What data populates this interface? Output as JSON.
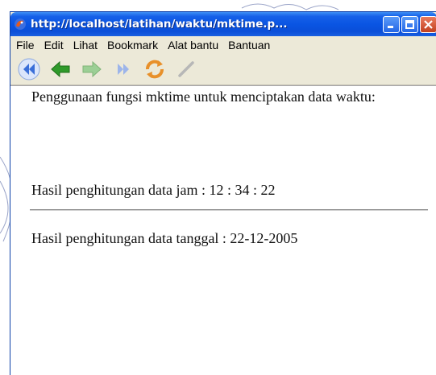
{
  "window": {
    "title": "http://localhost/latihan/waktu/mktime.p...",
    "controls": {
      "minimize": "minimize-icon",
      "maximize": "maximize-icon",
      "close": "close-icon"
    }
  },
  "menubar": {
    "items": [
      "File",
      "Edit",
      "Lihat",
      "Bookmark",
      "Alat bantu",
      "Bantuan"
    ]
  },
  "toolbar": {
    "icons": [
      "rewind-icon",
      "back-arrow-icon",
      "forward-arrow-icon",
      "fast-forward-icon",
      "reload-icon",
      "stop-icon"
    ]
  },
  "content": {
    "intro": "Penggunaan fungsi mktime untuk menciptakan data waktu:",
    "time_line": "Hasil penghitungan data jam : 12 : 34 : 22",
    "date_line": "Hasil penghitungan data tanggal : 22-12-2005"
  },
  "colors": {
    "titlebar": "#0a55e3",
    "chrome": "#ece9d8",
    "arrow_green": "#2f9a2a",
    "arrow_blue": "#3a6fd8"
  }
}
